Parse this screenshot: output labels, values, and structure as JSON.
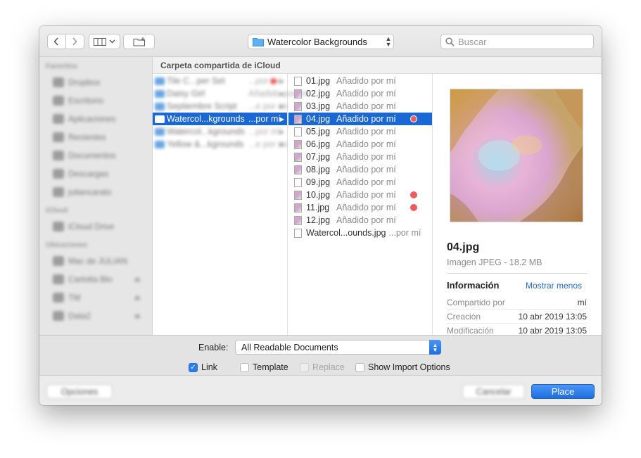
{
  "toolbar": {
    "back_icon": "chevron-left-icon",
    "forward_icon": "chevron-right-icon",
    "view_icon": "columns-view-icon",
    "new_folder_icon": "new-folder-icon",
    "path_label": "Watercolor  Backgrounds",
    "search_placeholder": "Buscar"
  },
  "sidebar": {
    "sections": [
      {
        "title": "Favoritos",
        "items": [
          "Dropbox",
          "Escritorio",
          "Aplicaciones",
          "Recientes",
          "Documentos",
          "Descargas",
          "juliancarato"
        ]
      },
      {
        "title": "iCloud",
        "items": [
          "iCloud Drive"
        ]
      },
      {
        "title": "Ubicaciones",
        "items": [
          "Mac de JULIAN",
          "Carlotta Blo",
          "TM",
          "Data2"
        ]
      }
    ]
  },
  "path_header": "Carpeta compartida de iCloud",
  "column1": [
    {
      "name": "Tile C...per Set",
      "by": "...por mí",
      "dot": true
    },
    {
      "name": "Daisy Girl",
      "by": "Añadido por mí",
      "dot": false
    },
    {
      "name": "Septiembre Script",
      "by": "...e por mí",
      "dot": false
    },
    {
      "name": "Watercol...kgrounds",
      "by": "...por mí",
      "dot": false,
      "selected": true
    },
    {
      "name": "Watercol...kgrounds",
      "by": "...por mí",
      "dot": false
    },
    {
      "name": "Yellow &...kgrounds",
      "by": "...e por mí",
      "dot": false
    }
  ],
  "column2": [
    {
      "name": "01.jpg",
      "by": "Añadido por mí",
      "dot": false,
      "plain": true
    },
    {
      "name": "02.jpg",
      "by": "Añadido por mí",
      "dot": false
    },
    {
      "name": "03.jpg",
      "by": "Añadido por mí",
      "dot": false
    },
    {
      "name": "04.jpg",
      "by": "Añadido por mí",
      "dot": true,
      "selected": true
    },
    {
      "name": "05.jpg",
      "by": "Añadido por mí",
      "dot": false,
      "plain": true
    },
    {
      "name": "06.jpg",
      "by": "Añadido por mí",
      "dot": false
    },
    {
      "name": "07.jpg",
      "by": "Añadido por mí",
      "dot": false
    },
    {
      "name": "08.jpg",
      "by": "Añadido por mí",
      "dot": false
    },
    {
      "name": "09.jpg",
      "by": "Añadido por mí",
      "dot": false,
      "plain": true
    },
    {
      "name": "10.jpg",
      "by": "Añadido por mí",
      "dot": true
    },
    {
      "name": "11.jpg",
      "by": "Añadido por mí",
      "dot": true
    },
    {
      "name": "12.jpg",
      "by": "Añadido por mí",
      "dot": false
    },
    {
      "name": "Watercol...ounds.jpg",
      "by": "...por mí",
      "dot": false,
      "plain": true,
      "long": true
    }
  ],
  "preview": {
    "file_name": "04.jpg",
    "kind": "Imagen JPEG - 18.2 MB",
    "info_title": "Información",
    "show_less": "Mostrar menos",
    "rows": [
      {
        "key": "Compartido por",
        "value": "mí"
      },
      {
        "key": "Creación",
        "value": "10 abr 2019 13:05"
      },
      {
        "key": "Modificación",
        "value": "10 abr 2019 13:05"
      }
    ]
  },
  "options": {
    "enable_label": "Enable:",
    "enable_value": "All Readable Documents",
    "checkboxes": [
      {
        "label": "Link",
        "checked": true,
        "disabled": false
      },
      {
        "label": "Template",
        "checked": false,
        "disabled": false
      },
      {
        "label": "Replace",
        "checked": false,
        "disabled": true
      },
      {
        "label": "Show Import Options",
        "checked": false,
        "disabled": false
      }
    ]
  },
  "buttons": {
    "options": "Opciones",
    "cancel": "Cancelar",
    "place": "Place"
  },
  "colors": {
    "accent": "#1a68d5",
    "tag_red": "#ee5b5b"
  }
}
